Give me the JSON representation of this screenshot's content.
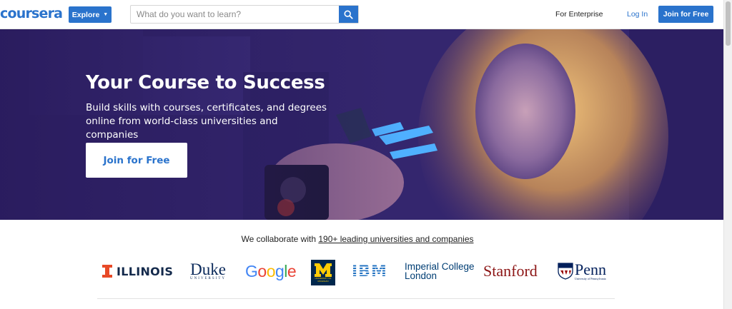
{
  "header": {
    "logo": "coursera",
    "explore_label": "Explore",
    "search_placeholder": "What do you want to learn?",
    "enterprise_label": "For Enterprise",
    "login_label": "Log In",
    "join_label": "Join for Free"
  },
  "hero": {
    "title": "Your Course to Success",
    "subtitle": "Build skills with courses, certificates, and degrees online from world-class universities and companies",
    "join_label": "Join for Free"
  },
  "partners": {
    "lead_text": "We collaborate with",
    "link_text": "190+ leading universities and companies",
    "logos": {
      "illinois": "ILLINOIS",
      "duke": "Duke",
      "duke_sub": "UNIVERSITY",
      "google": [
        "G",
        "o",
        "o",
        "g",
        "l",
        "e"
      ],
      "michigan_sub": "UNIVERSITY OF MICHIGAN",
      "ibm": "IBM",
      "imperial_line1": "Imperial College",
      "imperial_line2": "London",
      "stanford": "Stanford",
      "penn": "Penn",
      "penn_sub": "University of Pennsylvania"
    }
  },
  "colors": {
    "brand_blue": "#2a73cc",
    "hero_purple": "#2e1f66",
    "illinois_orange": "#e84a27",
    "illinois_navy": "#13294b",
    "stanford_red": "#8c1515",
    "michigan_blue": "#00274c",
    "michigan_maize": "#ffcb05",
    "ibm_blue": "#1f70c1",
    "imperial_navy": "#003e74",
    "penn_navy": "#011f5b"
  },
  "icons": {
    "search": "search-icon",
    "chevron": "chevron-down-icon"
  }
}
